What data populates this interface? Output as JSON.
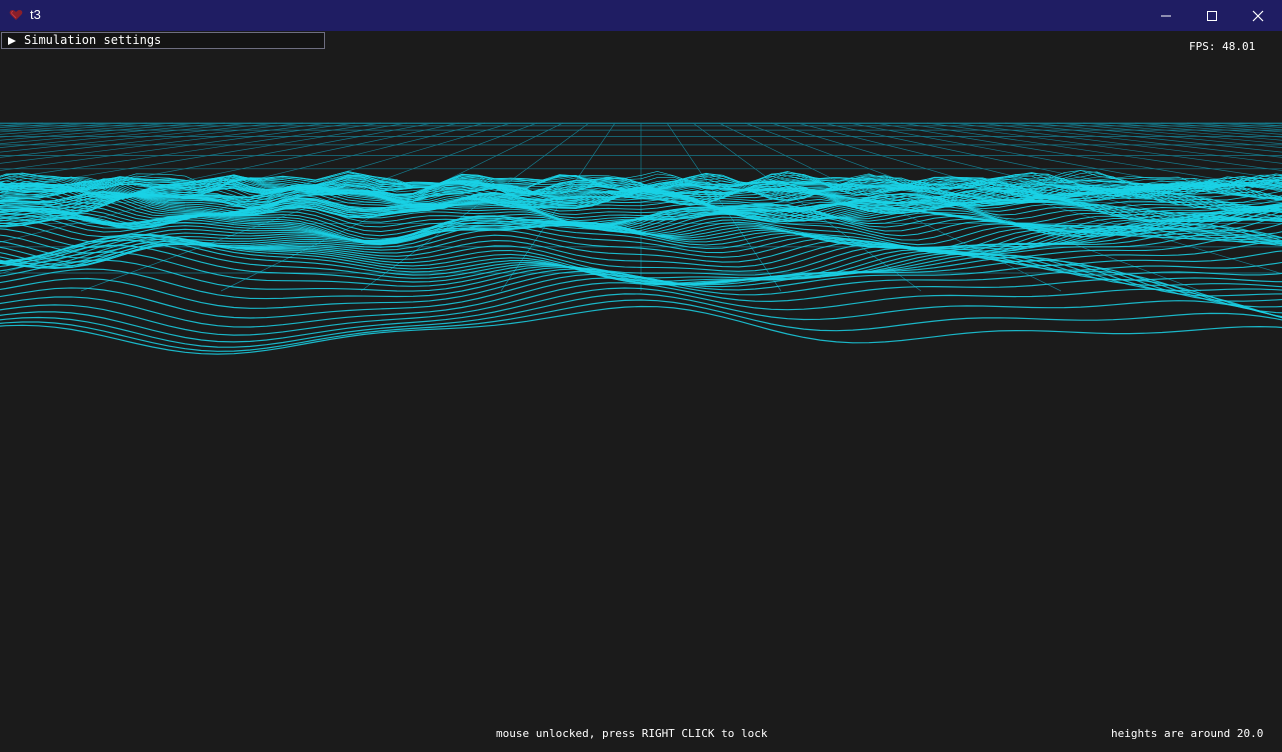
{
  "window": {
    "title": "t3",
    "icon": "app-heart-icon",
    "controls": [
      "minimize-icon",
      "maximize-icon",
      "close-icon"
    ]
  },
  "panel": {
    "settings_label": "Simulation settings",
    "expanded": false
  },
  "overlay": {
    "fps_label": "FPS: 48.01",
    "status_left": "mouse unlocked, press RIGHT CLICK to lock",
    "status_right": "heights are around 20.0"
  },
  "colors": {
    "titlebar": "#1f1d63",
    "background": "#1b1b1b",
    "wireframe": "#1ad2e6",
    "grid": "#157a8c"
  }
}
